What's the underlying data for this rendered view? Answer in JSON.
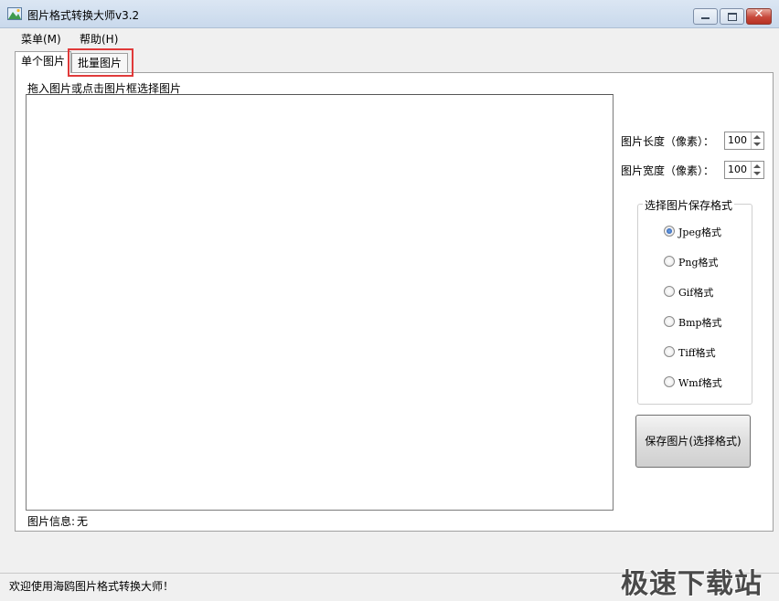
{
  "window": {
    "title": "图片格式转换大师v3.2",
    "close_glyph": "✕"
  },
  "menu": [
    "菜单(M)",
    "帮助(H)"
  ],
  "tabs": [
    {
      "label": "单个图片",
      "active": true
    },
    {
      "label": "批量图片",
      "active": false
    }
  ],
  "panel": {
    "drop_hint": "拖入图片或点击图片框选择图片",
    "info_label": "图片信息:",
    "info_value": "无"
  },
  "size": {
    "length_label": "图片长度（像素）：",
    "length_value": "100",
    "width_label": "图片宽度（像素）：",
    "width_value": "100"
  },
  "format_group": {
    "title": "选择图片保存格式",
    "options": [
      {
        "label": "Jpeg格式",
        "checked": true
      },
      {
        "label": "Png格式",
        "checked": false
      },
      {
        "label": "Gif格式",
        "checked": false
      },
      {
        "label": "Bmp格式",
        "checked": false
      },
      {
        "label": "Tiff格式",
        "checked": false
      },
      {
        "label": "Wmf格式",
        "checked": false
      }
    ]
  },
  "save_button": "保存图片(选择格式)",
  "status": "欢迎使用海鸥图片格式转换大师！",
  "watermark": "极速下载站",
  "colors": {
    "highlight_border": "#e03a3a",
    "radio_checked": "#1f4fa8"
  }
}
